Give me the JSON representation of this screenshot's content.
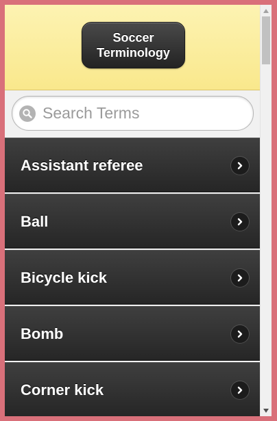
{
  "header": {
    "title": "Soccer\nTerminology"
  },
  "search": {
    "placeholder": "Search Terms",
    "value": ""
  },
  "list": {
    "items": [
      {
        "label": "Assistant referee"
      },
      {
        "label": "Ball"
      },
      {
        "label": "Bicycle kick"
      },
      {
        "label": "Bomb"
      },
      {
        "label": "Corner kick"
      }
    ]
  },
  "scrollbar": {
    "position": 0.0
  },
  "colors": {
    "header_bg": "#f9e88c",
    "list_bg": "#2e2e2e",
    "window_border": "#d9707a"
  },
  "icons": {
    "search": "search-icon",
    "item_arrow": "chevron-right-icon"
  }
}
